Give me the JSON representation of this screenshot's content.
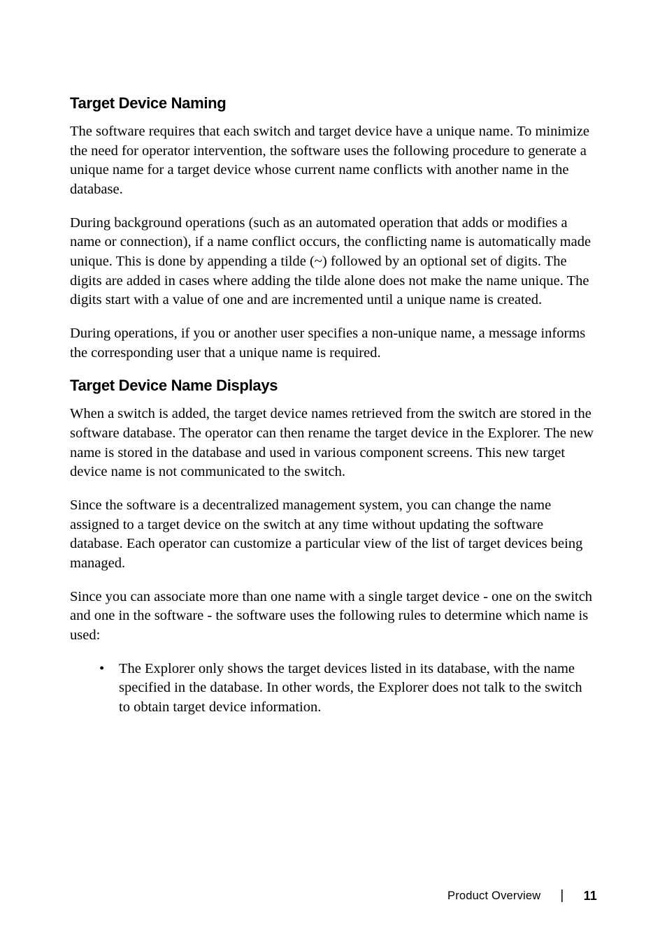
{
  "section1": {
    "heading": "Target Device Naming",
    "p1": "The software requires that each switch and target device have a unique name. To minimize the need for operator intervention, the software uses the following procedure to generate a unique name for a target device whose current name conflicts with another name in the database.",
    "p2": "During background operations (such as an automated operation that adds or modifies a name or connection), if a name conflict occurs, the conflicting name is automatically made unique. This is done by appending a tilde (~) followed by an optional set of digits. The digits are added in cases where adding the tilde alone does not make the name unique. The digits start with a value of one and are incremented until a unique name is created.",
    "p3": "During operations, if you or another user specifies a non-unique name, a message informs the corresponding user that a unique name is required."
  },
  "section2": {
    "heading": "Target Device Name Displays",
    "p1": "When a switch is added, the target device names retrieved from the switch are stored in the software database. The operator can then rename the target device in the Explorer. The new name is stored in the database and used in various component screens. This new target device name is not communicated to the switch.",
    "p2": "Since the software is a decentralized management system, you can change the name assigned to a target device on the switch at any time without updating the software database. Each operator can customize a particular view of the list of target devices being managed.",
    "p3": "Since you can associate more than one name with a single target device - one on the switch and one in the software - the software uses the following rules to determine which name is used:",
    "bullet1": "The Explorer only shows the target devices listed in its database, with the name specified in the database. In other words, the Explorer does not talk to the switch to obtain target device information."
  },
  "footer": {
    "label": "Product Overview",
    "separator": "|",
    "page": "11"
  }
}
